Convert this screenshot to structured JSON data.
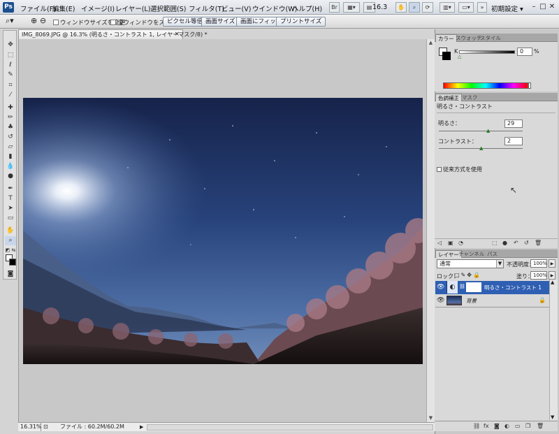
{
  "app": {
    "logo": "Ps"
  },
  "menu": {
    "items": [
      "ファイル(F)",
      "編集(E)",
      "イメージ(I)",
      "レイヤー(L)",
      "選択範囲(S)",
      "フィルタ(T)",
      "ビュー(V)",
      "ウインドウ(W)",
      "ヘルプ(H)"
    ],
    "br_label": "Br",
    "zoom_value": "16.3",
    "workspace": "初期設定",
    "window_minimize": "–",
    "window_restore": "□",
    "window_close": "✕"
  },
  "options": {
    "resize_window": "ウィンドウサイズを変更",
    "zoom_all": "全ウィンドウをズーム",
    "actual_pixels": "ピクセル等倍",
    "fit_screen": "画面サイズ",
    "fill_screen": "画面にフィット",
    "print_size": "プリントサイズ"
  },
  "document": {
    "tab_title": "IMG_8069.JPG @ 16.3% (明るさ・コントラスト 1, レイヤーマスク/8) *",
    "close": "×"
  },
  "status": {
    "zoom": "16.31%",
    "file": "ファイル : 60.2M/60.2M",
    "arrow": "▶"
  },
  "color_panel": {
    "tabs": [
      "カラー",
      "スウォッチ",
      "スタイル"
    ],
    "channel_label": "K",
    "value": "0",
    "unit": "%"
  },
  "adjust_panel": {
    "tabs": [
      "色調補正",
      "マスク"
    ],
    "title": "明るさ・コントラスト",
    "brightness_label": "明るさ：",
    "brightness_value": "29",
    "contrast_label": "コントラスト：",
    "contrast_value": "2",
    "legacy_label": "従来方式を使用"
  },
  "layers_panel": {
    "tabs": [
      "レイヤー",
      "チャンネル",
      "パス"
    ],
    "blend_mode": "通常",
    "opacity_label": "不透明度：",
    "opacity_value": "100%",
    "lock_label": "ロック：",
    "fill_label": "塗り：",
    "fill_value": "100%",
    "layers": [
      {
        "name": "明るさ・コントラスト 1",
        "selected": true
      },
      {
        "name": "背景",
        "selected": false
      }
    ]
  },
  "colors": {
    "accent": "#2a5db0",
    "panel": "#d9d9d9",
    "canvas": "#c8c8c8"
  },
  "icons": [
    "zoom-tool-icon",
    "move-tool-icon",
    "marquee-tool-icon",
    "lasso-tool-icon",
    "brush-tool-icon",
    "type-tool-icon",
    "hand-tool-icon",
    "eye-icon",
    "lock-icon",
    "trash-icon"
  ]
}
